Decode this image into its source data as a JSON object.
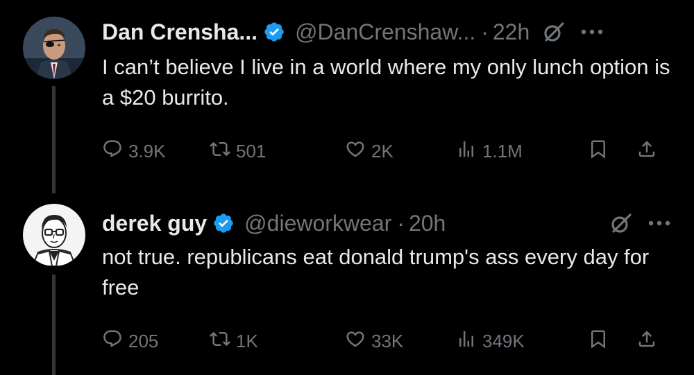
{
  "tweets": [
    {
      "display_name": "Dan Crensha...",
      "handle": "@DanCrenshaw...",
      "separator": "·",
      "time": "22h",
      "text": "I can’t believe I live in a world where my only lunch option is a $20 burrito.",
      "replies": "3.9K",
      "retweets": "501",
      "likes": "2K",
      "views": "1.1M"
    },
    {
      "display_name": "derek guy",
      "handle": "@dieworkwear",
      "separator": "·",
      "time": "20h",
      "text": "not true. republicans eat donald trump's ass every day for free",
      "replies": "205",
      "retweets": "1K",
      "likes": "33K",
      "views": "349K"
    }
  ],
  "icons": {
    "verified": "verified-badge-icon",
    "grok": "grok-slash-circle-icon",
    "more": "more-horizontal-icon",
    "reply": "reply-bubble-icon",
    "retweet": "retweet-arrows-icon",
    "like": "heart-icon",
    "views": "views-bars-icon",
    "bookmark": "bookmark-icon",
    "share": "share-upload-icon"
  },
  "colors": {
    "background": "#000000",
    "text_primary": "#e7e9ea",
    "text_secondary": "#71767b",
    "verified_blue": "#1d9bf0",
    "thread_line": "#333639"
  }
}
